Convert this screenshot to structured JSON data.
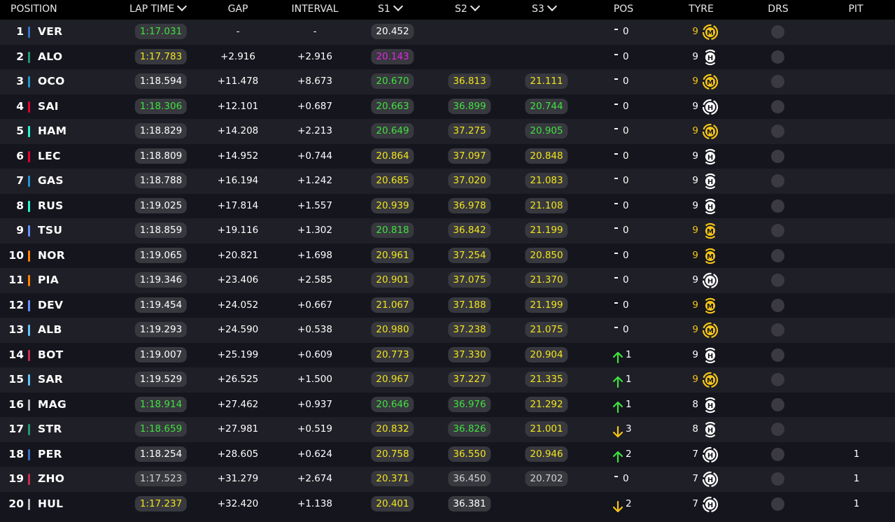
{
  "colors": {
    "header_bg": "#000000",
    "row_bg_a": "#1f1f27",
    "row_bg_b": "#15151e",
    "pill_bg": "#38383f",
    "personal_best": "#3fe23f",
    "sector_normal": "#f1e51b",
    "overall_best": "#e426e4",
    "medium_tyre": "#f5c518",
    "hard_tyre": "#ffffff",
    "pos_up": "#3fe23f",
    "pos_down": "#f5c518"
  },
  "headers": {
    "position": "POSITION",
    "lap_time": "LAP TIME",
    "gap": "GAP",
    "interval": "INTERVAL",
    "s1": "S1",
    "s2": "S2",
    "s3": "S3",
    "pos": "POS",
    "tyre": "TYRE",
    "drs": "DRS",
    "pit": "PIT"
  },
  "rows": [
    {
      "pos": "1",
      "team_color": "#3671c6",
      "driver": "VER",
      "lap": "1:17.031",
      "lap_c": "green",
      "gap": "-",
      "interval": "-",
      "s1": "20.452",
      "s1_c": "white",
      "s2": "",
      "s2_c": "",
      "s3": "",
      "s3_c": "",
      "pos_dir": "none",
      "pos_chg": "0",
      "tyre_laps": "9",
      "tyre": "M",
      "tyre_icon": "medium-tyre-icon",
      "tyre_c": "yellow",
      "pit": ""
    },
    {
      "pos": "2",
      "team_color": "#229971",
      "driver": "ALO",
      "lap": "1:17.783",
      "lap_c": "yellow",
      "gap": "+2.916",
      "interval": "+2.916",
      "s1": "20.143",
      "s1_c": "purple",
      "s2": "",
      "s2_c": "",
      "s3": "",
      "s3_c": "",
      "pos_dir": "none",
      "pos_chg": "0",
      "tyre_laps": "9",
      "tyre": "H",
      "tyre_icon": "hard-tyre-new-icon",
      "tyre_c": "white",
      "pit": ""
    },
    {
      "pos": "3",
      "team_color": "#2293d1",
      "driver": "OCO",
      "lap": "1:18.594",
      "lap_c": "white",
      "gap": "+11.478",
      "interval": "+8.673",
      "s1": "20.670",
      "s1_c": "green",
      "s2": "36.813",
      "s2_c": "yellow",
      "s3": "21.111",
      "s3_c": "yellow",
      "pos_dir": "none",
      "pos_chg": "0",
      "tyre_laps": "9",
      "tyre": "M",
      "tyre_icon": "medium-tyre-icon",
      "tyre_c": "yellow",
      "pit": ""
    },
    {
      "pos": "4",
      "team_color": "#e8002d",
      "driver": "SAI",
      "lap": "1:18.306",
      "lap_c": "green",
      "gap": "+12.101",
      "interval": "+0.687",
      "s1": "20.663",
      "s1_c": "green",
      "s2": "36.899",
      "s2_c": "green",
      "s3": "20.744",
      "s3_c": "green",
      "pos_dir": "none",
      "pos_chg": "0",
      "tyre_laps": "9",
      "tyre": "H",
      "tyre_icon": "hard-tyre-icon",
      "tyre_c": "white",
      "pit": ""
    },
    {
      "pos": "5",
      "team_color": "#27f4d2",
      "driver": "HAM",
      "lap": "1:18.829",
      "lap_c": "white",
      "gap": "+14.208",
      "interval": "+2.213",
      "s1": "20.649",
      "s1_c": "green",
      "s2": "37.275",
      "s2_c": "yellow",
      "s3": "20.905",
      "s3_c": "green",
      "pos_dir": "none",
      "pos_chg": "0",
      "tyre_laps": "9",
      "tyre": "M",
      "tyre_icon": "medium-tyre-icon",
      "tyre_c": "yellow",
      "pit": ""
    },
    {
      "pos": "6",
      "team_color": "#e8002d",
      "driver": "LEC",
      "lap": "1:18.809",
      "lap_c": "white",
      "gap": "+14.952",
      "interval": "+0.744",
      "s1": "20.864",
      "s1_c": "yellow",
      "s2": "37.097",
      "s2_c": "yellow",
      "s3": "20.848",
      "s3_c": "yellow",
      "pos_dir": "none",
      "pos_chg": "0",
      "tyre_laps": "9",
      "tyre": "H",
      "tyre_icon": "hard-tyre-new-icon",
      "tyre_c": "white",
      "pit": ""
    },
    {
      "pos": "7",
      "team_color": "#2293d1",
      "driver": "GAS",
      "lap": "1:18.788",
      "lap_c": "white",
      "gap": "+16.194",
      "interval": "+1.242",
      "s1": "20.685",
      "s1_c": "yellow",
      "s2": "37.020",
      "s2_c": "yellow",
      "s3": "21.083",
      "s3_c": "yellow",
      "pos_dir": "none",
      "pos_chg": "0",
      "tyre_laps": "9",
      "tyre": "H",
      "tyre_icon": "hard-tyre-new-icon",
      "tyre_c": "white",
      "pit": ""
    },
    {
      "pos": "8",
      "team_color": "#27f4d2",
      "driver": "RUS",
      "lap": "1:19.025",
      "lap_c": "white",
      "gap": "+17.814",
      "interval": "+1.557",
      "s1": "20.939",
      "s1_c": "yellow",
      "s2": "36.978",
      "s2_c": "yellow",
      "s3": "21.108",
      "s3_c": "yellow",
      "pos_dir": "none",
      "pos_chg": "0",
      "tyre_laps": "9",
      "tyre": "H",
      "tyre_icon": "hard-tyre-new-icon",
      "tyre_c": "white",
      "pit": ""
    },
    {
      "pos": "9",
      "team_color": "#6692ff",
      "driver": "TSU",
      "lap": "1:18.859",
      "lap_c": "white",
      "gap": "+19.116",
      "interval": "+1.302",
      "s1": "20.818",
      "s1_c": "green",
      "s2": "36.842",
      "s2_c": "yellow",
      "s3": "21.199",
      "s3_c": "yellow",
      "pos_dir": "none",
      "pos_chg": "0",
      "tyre_laps": "9",
      "tyre": "M",
      "tyre_icon": "medium-tyre-new-icon",
      "tyre_c": "yellow",
      "pit": ""
    },
    {
      "pos": "10",
      "team_color": "#ff8000",
      "driver": "NOR",
      "lap": "1:19.065",
      "lap_c": "white",
      "gap": "+20.821",
      "interval": "+1.698",
      "s1": "20.961",
      "s1_c": "yellow",
      "s2": "37.254",
      "s2_c": "yellow",
      "s3": "20.850",
      "s3_c": "yellow",
      "pos_dir": "none",
      "pos_chg": "0",
      "tyre_laps": "9",
      "tyre": "M",
      "tyre_icon": "medium-tyre-new-icon",
      "tyre_c": "yellow",
      "pit": ""
    },
    {
      "pos": "11",
      "team_color": "#ff8000",
      "driver": "PIA",
      "lap": "1:19.346",
      "lap_c": "white",
      "gap": "+23.406",
      "interval": "+2.585",
      "s1": "20.901",
      "s1_c": "yellow",
      "s2": "37.075",
      "s2_c": "yellow",
      "s3": "21.370",
      "s3_c": "yellow",
      "pos_dir": "none",
      "pos_chg": "0",
      "tyre_laps": "9",
      "tyre": "H",
      "tyre_icon": "hard-tyre-icon",
      "tyre_c": "white",
      "pit": ""
    },
    {
      "pos": "12",
      "team_color": "#6692ff",
      "driver": "DEV",
      "lap": "1:19.454",
      "lap_c": "white",
      "gap": "+24.052",
      "interval": "+0.667",
      "s1": "21.067",
      "s1_c": "yellow",
      "s2": "37.188",
      "s2_c": "yellow",
      "s3": "21.199",
      "s3_c": "yellow",
      "pos_dir": "none",
      "pos_chg": "0",
      "tyre_laps": "9",
      "tyre": "M",
      "tyre_icon": "medium-tyre-new-icon",
      "tyre_c": "yellow",
      "pit": ""
    },
    {
      "pos": "13",
      "team_color": "#64c4ff",
      "driver": "ALB",
      "lap": "1:19.293",
      "lap_c": "white",
      "gap": "+24.590",
      "interval": "+0.538",
      "s1": "20.980",
      "s1_c": "yellow",
      "s2": "37.238",
      "s2_c": "yellow",
      "s3": "21.075",
      "s3_c": "yellow",
      "pos_dir": "none",
      "pos_chg": "0",
      "tyre_laps": "9",
      "tyre": "M",
      "tyre_icon": "medium-tyre-icon",
      "tyre_c": "yellow",
      "pit": ""
    },
    {
      "pos": "14",
      "team_color": "#c92d4b",
      "driver": "BOT",
      "lap": "1:19.007",
      "lap_c": "white",
      "gap": "+25.199",
      "interval": "+0.609",
      "s1": "20.773",
      "s1_c": "yellow",
      "s2": "37.330",
      "s2_c": "yellow",
      "s3": "20.904",
      "s3_c": "yellow",
      "pos_dir": "up",
      "pos_chg": "1",
      "tyre_laps": "9",
      "tyre": "H",
      "tyre_icon": "hard-tyre-new-icon",
      "tyre_c": "white",
      "pit": ""
    },
    {
      "pos": "15",
      "team_color": "#64c4ff",
      "driver": "SAR",
      "lap": "1:19.529",
      "lap_c": "white",
      "gap": "+26.525",
      "interval": "+1.500",
      "s1": "20.967",
      "s1_c": "yellow",
      "s2": "37.227",
      "s2_c": "yellow",
      "s3": "21.335",
      "s3_c": "yellow",
      "pos_dir": "up",
      "pos_chg": "1",
      "tyre_laps": "9",
      "tyre": "M",
      "tyre_icon": "medium-tyre-icon",
      "tyre_c": "yellow",
      "pit": ""
    },
    {
      "pos": "16",
      "team_color": "#b6babd",
      "driver": "MAG",
      "lap": "1:18.914",
      "lap_c": "green",
      "gap": "+27.462",
      "interval": "+0.937",
      "s1": "20.646",
      "s1_c": "green",
      "s2": "36.976",
      "s2_c": "green",
      "s3": "21.292",
      "s3_c": "yellow",
      "pos_dir": "up",
      "pos_chg": "1",
      "tyre_laps": "8",
      "tyre": "H",
      "tyre_icon": "hard-tyre-new-icon",
      "tyre_c": "white",
      "pit": ""
    },
    {
      "pos": "17",
      "team_color": "#229971",
      "driver": "STR",
      "lap": "1:18.659",
      "lap_c": "green",
      "gap": "+27.981",
      "interval": "+0.519",
      "s1": "20.832",
      "s1_c": "yellow",
      "s2": "36.826",
      "s2_c": "green",
      "s3": "21.001",
      "s3_c": "yellow",
      "pos_dir": "down",
      "pos_chg": "3",
      "tyre_laps": "8",
      "tyre": "H",
      "tyre_icon": "hard-tyre-new-icon",
      "tyre_c": "white",
      "pit": ""
    },
    {
      "pos": "18",
      "team_color": "#3671c6",
      "driver": "PER",
      "lap": "1:18.254",
      "lap_c": "white",
      "gap": "+28.605",
      "interval": "+0.624",
      "s1": "20.758",
      "s1_c": "yellow",
      "s2": "36.550",
      "s2_c": "yellow",
      "s3": "20.946",
      "s3_c": "yellow",
      "pos_dir": "up",
      "pos_chg": "2",
      "tyre_laps": "7",
      "tyre": "H",
      "tyre_icon": "hard-tyre-icon",
      "tyre_c": "white",
      "pit": "1"
    },
    {
      "pos": "19",
      "team_color": "#c92d4b",
      "driver": "ZHO",
      "lap": "1:17.523",
      "lap_c": "gray",
      "gap": "+31.279",
      "interval": "+2.674",
      "s1": "20.371",
      "s1_c": "yellow",
      "s2": "36.450",
      "s2_c": "gray",
      "s3": "20.702",
      "s3_c": "gray",
      "pos_dir": "none",
      "pos_chg": "0",
      "tyre_laps": "7",
      "tyre": "H",
      "tyre_icon": "hard-tyre-icon",
      "tyre_c": "white",
      "pit": "1"
    },
    {
      "pos": "20",
      "team_color": "#b6babd",
      "driver": "HUL",
      "lap": "1:17.237",
      "lap_c": "yellow",
      "gap": "+32.420",
      "interval": "+1.138",
      "s1": "20.401",
      "s1_c": "yellow",
      "s2": "36.381",
      "s2_c": "white",
      "s3": "",
      "s3_c": "",
      "pos_dir": "down",
      "pos_chg": "2",
      "tyre_laps": "7",
      "tyre": "H",
      "tyre_icon": "hard-tyre-icon",
      "tyre_c": "white",
      "pit": "1"
    }
  ]
}
